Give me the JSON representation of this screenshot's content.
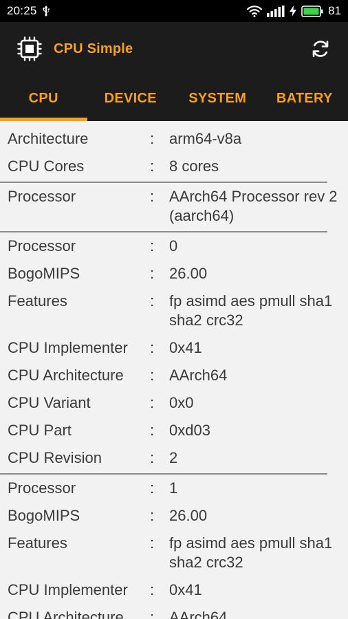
{
  "status": {
    "time": "20:25",
    "battery": "81"
  },
  "app": {
    "title": "CPU Simple"
  },
  "tabs": [
    "CPU",
    "DEVICE",
    "SYSTEM",
    "BATERY"
  ],
  "sep": ":",
  "rows": {
    "architecture": {
      "label": "Architecture",
      "value": "arm64-v8a"
    },
    "cores": {
      "label": "CPU Cores",
      "value": "8 cores"
    },
    "processor_name": {
      "label": "Processor",
      "value": "AArch64 Processor rev 2 (aarch64)"
    },
    "p0": {
      "processor": {
        "label": "Processor",
        "value": "0"
      },
      "bogomips": {
        "label": "BogoMIPS",
        "value": "26.00"
      },
      "features": {
        "label": "Features",
        "value": "fp asimd aes pmull sha1 sha2 crc32"
      },
      "implementer": {
        "label": "CPU Implementer",
        "value": "0x41"
      },
      "architecture": {
        "label": "CPU Architecture",
        "value": "AArch64"
      },
      "variant": {
        "label": "CPU Variant",
        "value": "0x0"
      },
      "part": {
        "label": "CPU Part",
        "value": "0xd03"
      },
      "revision": {
        "label": "CPU Revision",
        "value": "2"
      }
    },
    "p1": {
      "processor": {
        "label": "Processor",
        "value": "1"
      },
      "bogomips": {
        "label": "BogoMIPS",
        "value": "26.00"
      },
      "features": {
        "label": "Features",
        "value": "fp asimd aes pmull sha1 sha2 crc32"
      },
      "implementer": {
        "label": "CPU Implementer",
        "value": "0x41"
      },
      "architecture": {
        "label": "CPU Architecture",
        "value": "AArch64"
      }
    }
  },
  "colors": {
    "accent": "#f7a01d",
    "app_bar": "#1c1c1c",
    "background": "#f2f2f2",
    "text": "#3a3a3a"
  },
  "icons": {
    "usb": "usb-icon",
    "wifi": "wifi-icon",
    "signal": "signal-icon",
    "charging": "charging-icon",
    "battery": "battery-icon",
    "logo": "cpu-chip-icon",
    "refresh": "refresh-icon"
  }
}
